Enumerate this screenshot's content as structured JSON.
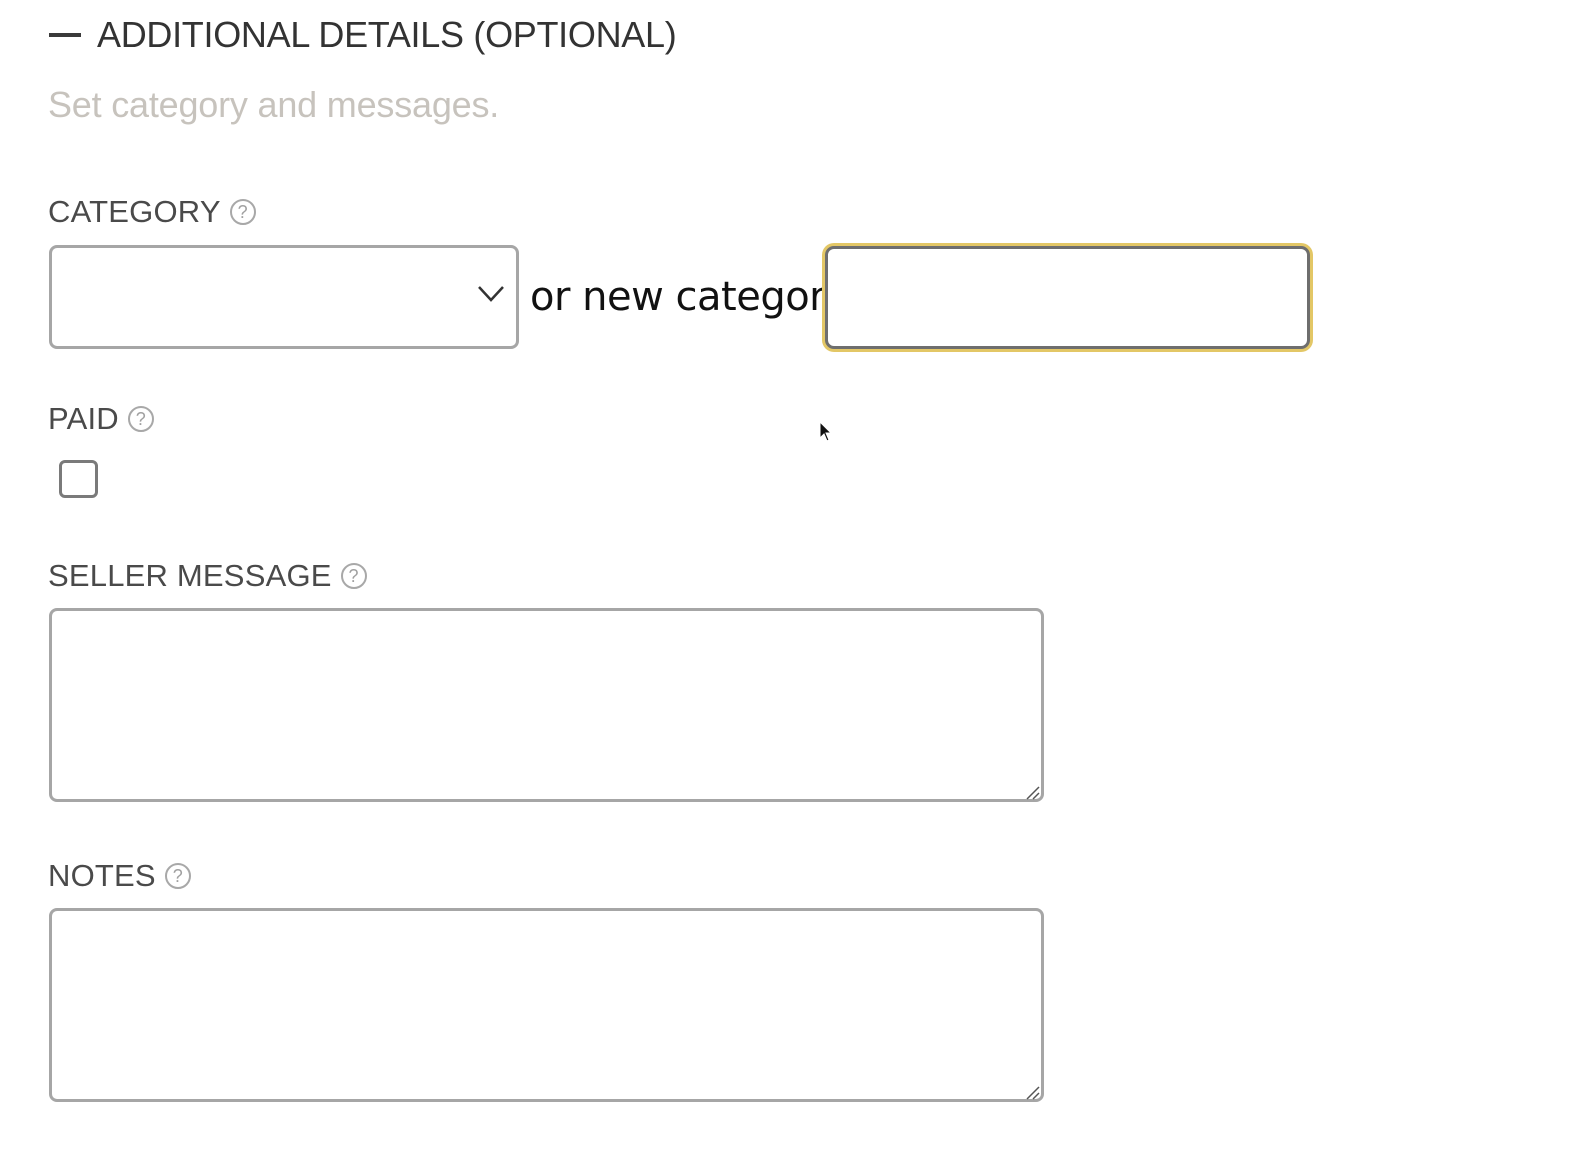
{
  "section": {
    "title": "ADDITIONAL DETAILS (OPTIONAL)",
    "subtitle": "Set category and messages.",
    "collapse_icon": "minus-icon"
  },
  "category": {
    "label": "CATEGORY",
    "help_icon": "?",
    "selected_value": "",
    "or_new_text": "or new category",
    "new_category_value": ""
  },
  "paid": {
    "label": "PAID",
    "help_icon": "?",
    "checked": false
  },
  "seller_message": {
    "label": "SELLER MESSAGE",
    "help_icon": "?",
    "value": ""
  },
  "notes": {
    "label": "NOTES",
    "help_icon": "?",
    "value": ""
  },
  "colors": {
    "focus_ring": "#e3c766",
    "subtitle": "#c7c3bd",
    "border": "#a6a6a6"
  }
}
